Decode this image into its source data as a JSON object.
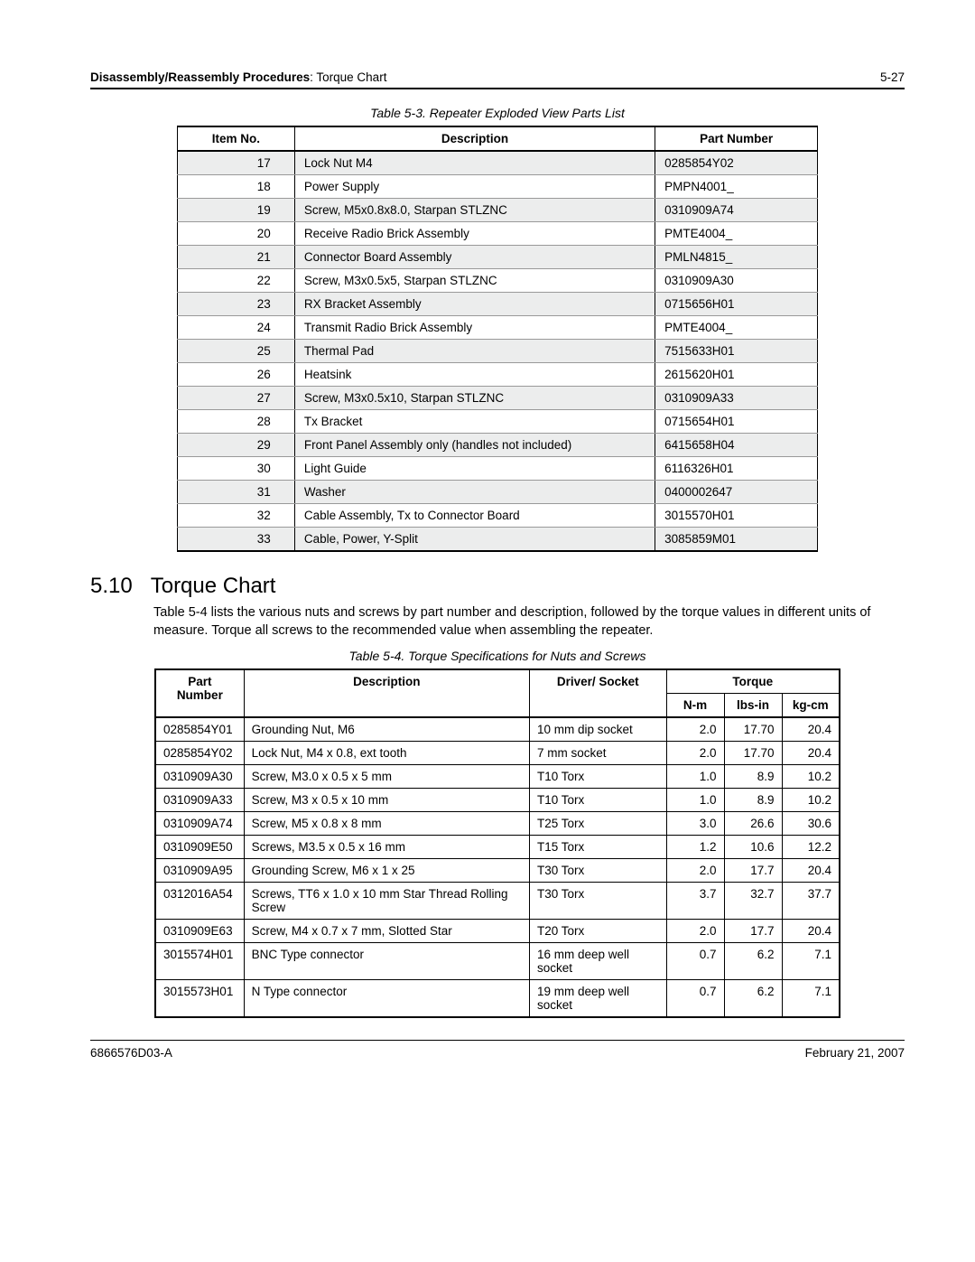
{
  "header": {
    "section_bold": "Disassembly/Reassembly Procedures",
    "section_rest": ": Torque Chart",
    "page_number": "5-27"
  },
  "table53": {
    "caption": "Table 5-3.  Repeater Exploded View Parts List",
    "columns": {
      "item": "Item No.",
      "desc": "Description",
      "pn": "Part Number"
    },
    "rows": [
      {
        "item": "17",
        "desc": "Lock Nut M4",
        "pn": "0285854Y02"
      },
      {
        "item": "18",
        "desc": "Power Supply",
        "pn": "PMPN4001_"
      },
      {
        "item": "19",
        "desc": "Screw, M5x0.8x8.0, Starpan STLZNC",
        "pn": "0310909A74"
      },
      {
        "item": "20",
        "desc": "Receive Radio Brick Assembly",
        "pn": "PMTE4004_"
      },
      {
        "item": "21",
        "desc": "Connector Board Assembly",
        "pn": "PMLN4815_"
      },
      {
        "item": "22",
        "desc": "Screw, M3x0.5x5, Starpan STLZNC",
        "pn": "0310909A30"
      },
      {
        "item": "23",
        "desc": "RX Bracket Assembly",
        "pn": "0715656H01"
      },
      {
        "item": "24",
        "desc": "Transmit Radio Brick Assembly",
        "pn": "PMTE4004_"
      },
      {
        "item": "25",
        "desc": "Thermal Pad",
        "pn": "7515633H01"
      },
      {
        "item": "26",
        "desc": "Heatsink",
        "pn": "2615620H01"
      },
      {
        "item": "27",
        "desc": "Screw, M3x0.5x10, Starpan STLZNC",
        "pn": "0310909A33"
      },
      {
        "item": "28",
        "desc": "Tx Bracket",
        "pn": "0715654H01"
      },
      {
        "item": "29",
        "desc": "Front Panel Assembly only (handles not included)",
        "pn": "6415658H04"
      },
      {
        "item": "30",
        "desc": "Light Guide",
        "pn": "6116326H01"
      },
      {
        "item": "31",
        "desc": "Washer",
        "pn": "0400002647"
      },
      {
        "item": "32",
        "desc": "Cable Assembly, Tx to Connector Board",
        "pn": "3015570H01"
      },
      {
        "item": "33",
        "desc": "Cable, Power, Y-Split",
        "pn": "3085859M01"
      }
    ]
  },
  "section": {
    "number": "5.10",
    "title": "Torque Chart",
    "paragraph": "Table 5-4 lists the various nuts and screws by part number and description, followed by the torque values in different units of measure. Torque all screws to the recommended value when assembling the repeater."
  },
  "table54": {
    "caption": "Table 5-4.  Torque Specifications for Nuts and Screws",
    "columns": {
      "pn": "Part Number",
      "desc": "Description",
      "driver": "Driver/ Socket",
      "torque": "Torque",
      "nm": "N-m",
      "lbsin": "lbs-in",
      "kgcm": "kg-cm"
    },
    "rows": [
      {
        "pn": "0285854Y01",
        "desc": "Grounding Nut, M6",
        "driver": "10 mm dip socket",
        "nm": "2.0",
        "lbsin": "17.70",
        "kgcm": "20.4"
      },
      {
        "pn": "0285854Y02",
        "desc": "Lock Nut, M4 x 0.8, ext tooth",
        "driver": "7 mm socket",
        "nm": "2.0",
        "lbsin": "17.70",
        "kgcm": "20.4"
      },
      {
        "pn": "0310909A30",
        "desc": "Screw, M3.0 x 0.5 x 5 mm",
        "driver": "T10 Torx",
        "nm": "1.0",
        "lbsin": "8.9",
        "kgcm": "10.2"
      },
      {
        "pn": "0310909A33",
        "desc": "Screw, M3 x 0.5 x 10 mm",
        "driver": "T10 Torx",
        "nm": "1.0",
        "lbsin": "8.9",
        "kgcm": "10.2"
      },
      {
        "pn": "0310909A74",
        "desc": "Screw, M5 x 0.8 x 8 mm",
        "driver": "T25 Torx",
        "nm": "3.0",
        "lbsin": "26.6",
        "kgcm": "30.6"
      },
      {
        "pn": "0310909E50",
        "desc": "Screws, M3.5 x 0.5 x 16 mm",
        "driver": "T15 Torx",
        "nm": "1.2",
        "lbsin": "10.6",
        "kgcm": "12.2"
      },
      {
        "pn": "0310909A95",
        "desc": "Grounding Screw, M6 x 1 x 25",
        "driver": "T30 Torx",
        "nm": "2.0",
        "lbsin": "17.7",
        "kgcm": "20.4"
      },
      {
        "pn": "0312016A54",
        "desc": "Screws, TT6 x 1.0 x 10 mm Star Thread Rolling Screw",
        "driver": "T30 Torx",
        "nm": "3.7",
        "lbsin": "32.7",
        "kgcm": "37.7"
      },
      {
        "pn": "0310909E63",
        "desc": "Screw, M4 x 0.7 x 7 mm, Slotted Star",
        "driver": "T20 Torx",
        "nm": "2.0",
        "lbsin": "17.7",
        "kgcm": "20.4"
      },
      {
        "pn": "3015574H01",
        "desc": "BNC Type connector",
        "driver": "16 mm deep well socket",
        "nm": "0.7",
        "lbsin": "6.2",
        "kgcm": "7.1"
      },
      {
        "pn": "3015573H01",
        "desc": "N Type connector",
        "driver": "19 mm deep well socket",
        "nm": "0.7",
        "lbsin": "6.2",
        "kgcm": "7.1"
      }
    ]
  },
  "footer": {
    "doc_id": "6866576D03-A",
    "date": "February 21, 2007"
  }
}
